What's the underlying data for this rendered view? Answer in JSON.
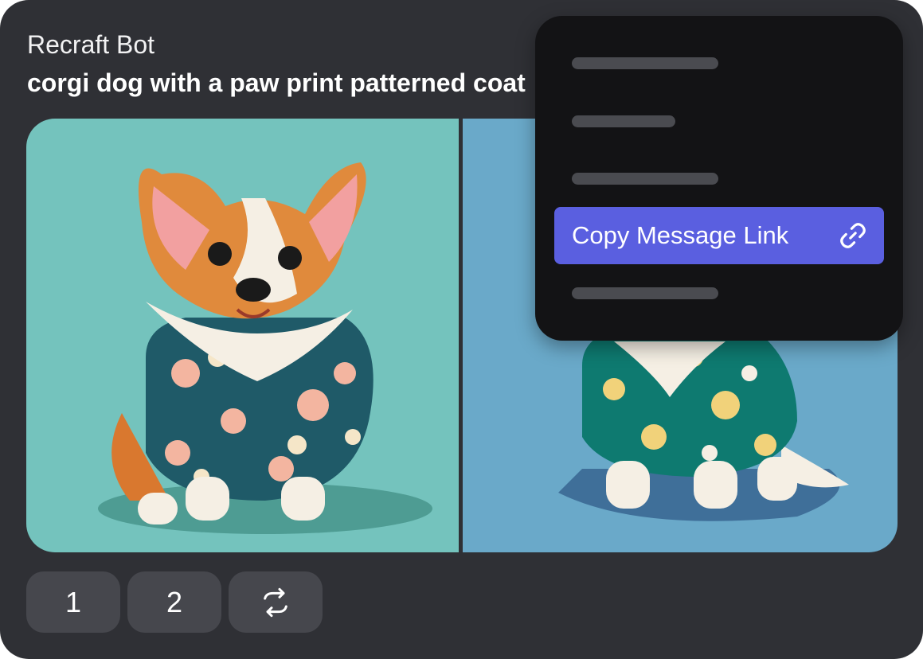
{
  "message": {
    "author": "Recraft Bot",
    "prompt": "corgi dog with a paw print patterned coat"
  },
  "images": [
    {
      "name": "corgi in floral shirt, teal background"
    },
    {
      "name": "corgi in floral shirt, blue background"
    }
  ],
  "buttons": {
    "variant_1": "1",
    "variant_2": "2",
    "regenerate_icon": "refresh-icon"
  },
  "context_menu": {
    "active_item_label": "Copy Message Link",
    "active_item_icon": "link-icon",
    "active_item_color": "#5a5fe0"
  },
  "colors": {
    "card_bg": "#2f3035",
    "menu_bg": "#131315",
    "left_image_bg": "#74c3bd",
    "right_image_bg": "#6aa9c9"
  }
}
